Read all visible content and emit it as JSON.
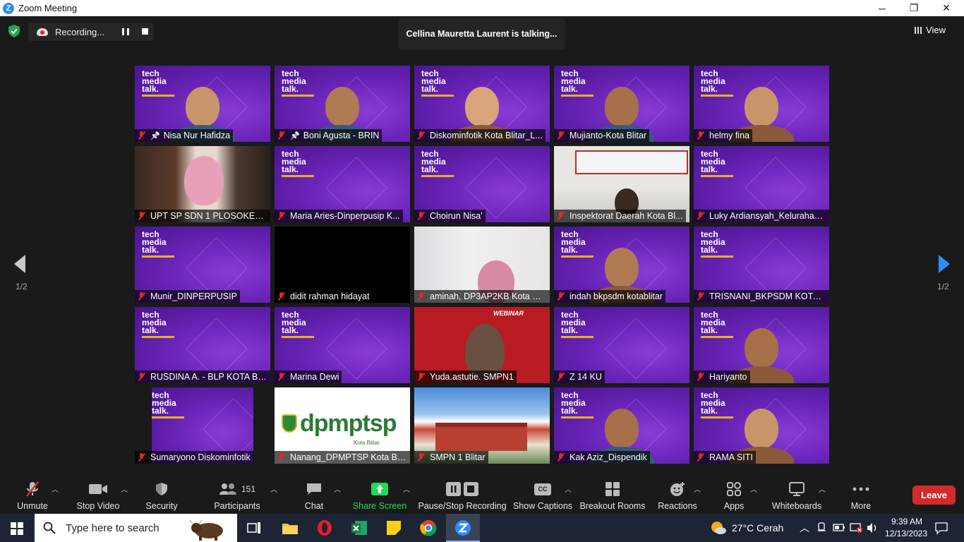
{
  "window": {
    "title": "Zoom Meeting",
    "minimize": "─",
    "maximize": "❐",
    "close": "✕"
  },
  "meeting": {
    "recording_label": "Recording...",
    "talking_text": "Cellina Mauretta Laurent is talking...",
    "view_label": "View",
    "page_left": "1/2",
    "page_right": "1/2"
  },
  "participants": [
    {
      "name": "Nisa Nur Hafidza",
      "pinned": true,
      "video": "purple-person"
    },
    {
      "name": "Boni Agusta - BRIN",
      "pinned": true,
      "video": "purple-person"
    },
    {
      "name": "Diskominfotik Kota Blitar_L...",
      "pinned": false,
      "video": "purple-avatar"
    },
    {
      "name": "Mujianto-Kota Blitar",
      "pinned": false,
      "video": "purple-person"
    },
    {
      "name": "helmy fina",
      "pinned": false,
      "video": "purple-avatar"
    },
    {
      "name": "UPT SP SDN 1 PLOSOKERE...",
      "pinned": false,
      "video": "camera"
    },
    {
      "name": "Maria Aries-Dinperpusip K...",
      "pinned": false,
      "video": "purple"
    },
    {
      "name": "Choirun Nisa'",
      "pinned": false,
      "video": "purple"
    },
    {
      "name": "Inspektorat Daerah Kota Bl...",
      "pinned": false,
      "video": "camera-room"
    },
    {
      "name": "Luky Ardiansyah_Kelurahan...",
      "pinned": false,
      "video": "purple"
    },
    {
      "name": "Munir_DINPERPUSIP",
      "pinned": false,
      "video": "purple"
    },
    {
      "name": "didit rahman hidayat",
      "pinned": false,
      "video": "black"
    },
    {
      "name": "aminah, DP3AP2KB Kota Bli...",
      "pinned": false,
      "video": "camera-light"
    },
    {
      "name": "indah bkpsdm kotablitar",
      "pinned": false,
      "video": "purple-avatar"
    },
    {
      "name": "TRISNANI_BKPSDM KOTA B...",
      "pinned": false,
      "video": "purple"
    },
    {
      "name": "RUSDINA A. - BLP KOTA BLI...",
      "pinned": false,
      "video": "purple"
    },
    {
      "name": "Marina Dewi",
      "pinned": false,
      "video": "purple"
    },
    {
      "name": "Yuda.astutie. SMPN1",
      "pinned": false,
      "video": "webinar"
    },
    {
      "name": "Z 14 KU",
      "pinned": false,
      "video": "purple"
    },
    {
      "name": "Hariyanto",
      "pinned": false,
      "video": "purple-avatar"
    },
    {
      "name": "Sumaryono Diskominfotik",
      "pinned": false,
      "video": "purple-narrow"
    },
    {
      "name": "Nanang_DPMPTSP Kota Bli...",
      "pinned": false,
      "video": "dpmptsp"
    },
    {
      "name": "SMPN 1 Blitar",
      "pinned": false,
      "video": "building"
    },
    {
      "name": "Kak Aziz_Dispendik",
      "pinned": false,
      "video": "purple-person"
    },
    {
      "name": "RAMA SITI",
      "pinned": false,
      "video": "purple-avatar"
    }
  ],
  "tile_brand": {
    "line1": "tech",
    "line2": "media",
    "line3": "talk.",
    "dpm_logo": "dpmptsp",
    "dpm_sub": "Kota Blitar",
    "webinar": "WEBINAR"
  },
  "toolbar": {
    "unmute": "Unmute",
    "stop_video": "Stop Video",
    "security": "Security",
    "participants": "Participants",
    "participants_count": "151",
    "chat": "Chat",
    "share_screen": "Share Screen",
    "pause_stop_recording": "Pause/Stop Recording",
    "show_captions": "Show Captions",
    "cc": "CC",
    "breakout_rooms": "Breakout Rooms",
    "reactions": "Reactions",
    "apps": "Apps",
    "whiteboards": "Whiteboards",
    "more": "More",
    "leave": "Leave"
  },
  "taskbar": {
    "search_placeholder": "Type here to search",
    "weather": "27°C  Cerah",
    "time": "9:39 AM",
    "date": "12/13/2023"
  },
  "colors": {
    "accent_blue": "#2d8cff",
    "share_green": "#23d959",
    "leave_red": "#d22b2b",
    "muted_red": "#e02828",
    "tile_purple": "#6a24b8"
  }
}
